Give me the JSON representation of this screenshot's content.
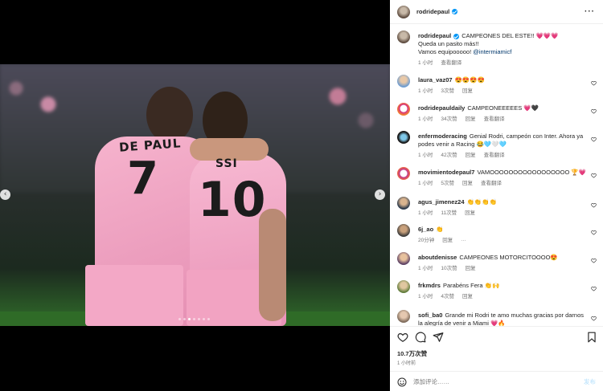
{
  "post": {
    "author": "rodridepaul",
    "caption_title": "CAMPEONES DEL ESTE!! 💗💗💗",
    "caption_line2": "Queda un pasito más!!",
    "caption_line3": "Vamos equipooooo!",
    "caption_mention": "@intermiamicf",
    "caption_time": "1 小时",
    "see_translation": "查看翻译"
  },
  "photo": {
    "jersey1_name": "DE PAUL",
    "jersey1_number": "7",
    "jersey2_name": "SSI",
    "jersey2_number": "10"
  },
  "comments": [
    {
      "user": "laura_vaz07",
      "text": "😍😍😍😍",
      "time": "1 小时",
      "likes": "3次赞",
      "reply": "回复",
      "translate": ""
    },
    {
      "user": "rodridepauldaily",
      "text": "CAMPEONEEEEES 💗🖤",
      "time": "1 小时",
      "likes": "34次赞",
      "reply": "回复",
      "translate": "查看翻译"
    },
    {
      "user": "enfermoderacing",
      "text": "Genial Rodri, campeón con Inter. Ahora ya podes venir a Racing 😂🩵🤍🩵",
      "time": "1 小时",
      "likes": "42次赞",
      "reply": "回复",
      "translate": "查看翻译"
    },
    {
      "user": "movimientodepaul7",
      "text": "VAMOOOOOOOOOOOOOOOOO 🏆💗",
      "time": "1 小时",
      "likes": "5次赞",
      "reply": "回复",
      "translate": "查看翻译"
    },
    {
      "user": "agus_jimenez24",
      "text": "👏👏👏👏",
      "time": "1 小时",
      "likes": "11次赞",
      "reply": "回复",
      "translate": ""
    },
    {
      "user": "6j_ao",
      "text": "👏",
      "time": "20分钟",
      "likes": "",
      "reply": "回复",
      "translate": ""
    },
    {
      "user": "aboutdenisse",
      "text": "CAMPEONES MOTORCITOOOO😍",
      "time": "1 小时",
      "likes": "10次赞",
      "reply": "回复",
      "translate": ""
    },
    {
      "user": "frkmdrs",
      "text": "Parabéns Fera 👏🙌",
      "time": "1 小时",
      "likes": "4次赞",
      "reply": "回复",
      "translate": ""
    },
    {
      "user": "sofi_ba0",
      "text": "Grande mi Rodri te amo muchas gracias por darnos la alegría de venir a Miami 💗🔥",
      "time": "",
      "likes": "",
      "reply": "",
      "translate": ""
    }
  ],
  "actions": {
    "likes_count": "10.7万次赞",
    "posted_ago": "1 小时前",
    "comment_placeholder": "添加评论……",
    "post_button": "发布"
  },
  "icons": {
    "prev": "chevron-left-icon",
    "next": "chevron-right-icon",
    "like": "heart-icon",
    "comment": "comment-icon",
    "share": "share-icon",
    "save": "bookmark-icon",
    "emoji": "emoji-icon",
    "more": "more-icon",
    "verified": "verified-badge-icon"
  },
  "colors": {
    "link": "#00376b",
    "verified": "#0095f6",
    "muted": "#737373",
    "post_button": "#b2dffc"
  }
}
